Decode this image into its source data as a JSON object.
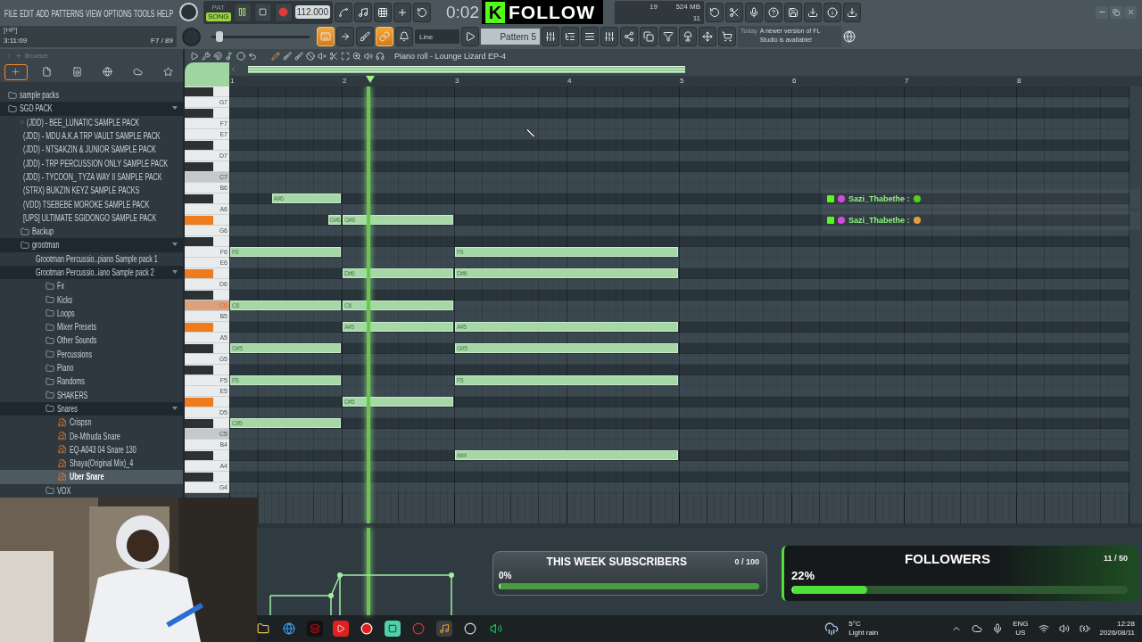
{
  "menu": [
    "FILE",
    "EDIT",
    "ADD",
    "PATTERNS",
    "VIEW",
    "OPTIONS",
    "TOOLS",
    "HELP"
  ],
  "mode": [
    {
      "label": "PAT",
      "selected": false
    },
    {
      "label": "SONG",
      "selected": true
    }
  ],
  "tempo": "112.000",
  "time": "0:02",
  "follow_overlay": {
    "logo": "K",
    "text": "FOLLOW"
  },
  "cpu": {
    "polyphony": "19",
    "memory": "524 MB",
    "cpu": "11"
  },
  "hint": {
    "title": "[HP]",
    "value": "3:11:09",
    "info": "F7 / 89"
  },
  "pitch_slider": {
    "level": 0.05
  },
  "toggles": [
    {
      "on": true
    },
    {
      "on": false
    },
    {
      "on": false
    },
    {
      "on": true
    },
    {
      "on": false
    }
  ],
  "snap": "Line",
  "pattern": "Pattern 5",
  "news": {
    "date": "Today",
    "message": "A newer version of FL Studio is available!"
  },
  "browser": {
    "title": "Browser",
    "tree": [
      {
        "kind": "folder",
        "label": "sample packs",
        "selected": false
      },
      {
        "kind": "folder",
        "label": "SGD PACK",
        "expanded": true,
        "selected": false,
        "children": [
          {
            "kind": "folder",
            "label": "(JDD) - BEE_LUNATIC SAMPLE PACK",
            "selected": false
          },
          {
            "kind": "folder",
            "label": "(JDD) - MDU A.K.A TRP VAULT SAMPLE PACK",
            "selected": false
          },
          {
            "kind": "folder",
            "label": "(JDD) - NTSAKZIN & JUNIOR SAMPLE PACK",
            "selected": false
          },
          {
            "kind": "folder",
            "label": "(JDD) - TRP PERCUSSION ONLY SAMPLE PACK",
            "selected": false
          },
          {
            "kind": "folder",
            "label": "(JDD) - TYCOON_ TYZA WAY II SAMPLE PACK",
            "selected": false
          },
          {
            "kind": "folder",
            "label": "(STRX) BUKZIN KEYZ SAMPLE PACKS",
            "selected": false
          },
          {
            "kind": "folder",
            "label": "(VDD) TSEBEBE MOROKE SAMPLE PACK",
            "selected": false
          },
          {
            "kind": "folder",
            "label": "[UPS] ULTIMATE SGIDONGO SAMPLE PACK",
            "selected": false
          },
          {
            "kind": "folder",
            "label": "Backup",
            "selected": false
          },
          {
            "kind": "folder",
            "label": "grootman",
            "expanded": true,
            "selected": false,
            "children": [
              {
                "kind": "folder",
                "label": "Grootman Percussio..piano Sample pack 1",
                "selected": false
              },
              {
                "kind": "folder",
                "label": "Grootman Percussio..iano Sample pack 2",
                "expanded": true,
                "selected": false,
                "children": [
                  {
                    "kind": "folder",
                    "label": "Fx",
                    "selected": false
                  },
                  {
                    "kind": "folder",
                    "label": "Kicks",
                    "selected": false
                  },
                  {
                    "kind": "folder",
                    "label": "Loops",
                    "selected": false
                  },
                  {
                    "kind": "folder",
                    "label": "Mixer Presets",
                    "selected": false
                  },
                  {
                    "kind": "folder",
                    "label": "Other Sounds",
                    "selected": false
                  },
                  {
                    "kind": "folder",
                    "label": "Percussions",
                    "selected": false
                  },
                  {
                    "kind": "folder",
                    "label": "Piano",
                    "selected": false
                  },
                  {
                    "kind": "folder",
                    "label": "Randoms",
                    "selected": false
                  },
                  {
                    "kind": "folder",
                    "label": "SHAKERS",
                    "selected": false
                  },
                  {
                    "kind": "folder",
                    "label": "Snares",
                    "expanded": true,
                    "selected": false,
                    "children": [
                      {
                        "kind": "file",
                        "label": "Crispsn",
                        "selected": false
                      },
                      {
                        "kind": "file",
                        "label": "De-Mthuda Snare",
                        "selected": false
                      },
                      {
                        "kind": "file",
                        "label": "EQ-A043 04 Snare 130",
                        "selected": false
                      },
                      {
                        "kind": "file",
                        "label": "Shaya(Original Mix)_4",
                        "selected": false
                      },
                      {
                        "kind": "file",
                        "label": "Uber Snare",
                        "selected": true
                      }
                    ]
                  },
                  {
                    "kind": "folder",
                    "label": "VOX",
                    "selected": false
                  }
                ]
              }
            ]
          }
        ]
      }
    ]
  },
  "piano_roll": {
    "title": "Piano roll - Lounge Lizard EP-4",
    "bars": [
      "1",
      "2",
      "3",
      "4",
      "5",
      "6",
      "7",
      "8"
    ],
    "keys": [
      {
        "kind": "black",
        "pressed": false
      },
      {
        "kind": "white",
        "label": "G7",
        "pressed": false
      },
      {
        "kind": "black",
        "pressed": false
      },
      {
        "kind": "white",
        "label": "F7",
        "pressed": false
      },
      {
        "kind": "white",
        "label": "E7",
        "pressed": false
      },
      {
        "kind": "black",
        "pressed": false
      },
      {
        "kind": "white",
        "label": "D7",
        "pressed": false
      },
      {
        "kind": "black",
        "pressed": false
      },
      {
        "kind": "c",
        "label": "C7",
        "pressed": false
      },
      {
        "kind": "white",
        "label": "B6",
        "pressed": false
      },
      {
        "kind": "black",
        "pressed": false,
        "notes": [
          {
            "label": "A#6"
          }
        ]
      },
      {
        "kind": "white",
        "label": "A6",
        "pressed": false
      },
      {
        "kind": "black",
        "pressed": true,
        "notes": [
          {
            "label": "G#6"
          },
          {
            "label": "G#6"
          }
        ]
      },
      {
        "kind": "white",
        "label": "G6",
        "pressed": false
      },
      {
        "kind": "black",
        "pressed": false
      },
      {
        "kind": "white",
        "label": "F6",
        "pressed": false,
        "notes": [
          {
            "label": "F6"
          },
          {
            "label": "F6"
          }
        ]
      },
      {
        "kind": "white",
        "label": "E6",
        "pressed": false
      },
      {
        "kind": "black",
        "pressed": true,
        "notes": [
          {
            "label": "D#6"
          },
          {
            "label": "D#6"
          }
        ]
      },
      {
        "kind": "white",
        "label": "D6",
        "pressed": false
      },
      {
        "kind": "black",
        "pressed": false
      },
      {
        "kind": "c",
        "label": "C6",
        "pressed": true,
        "notes": [
          {
            "label": "C6"
          },
          {
            "label": "C6"
          }
        ]
      },
      {
        "kind": "white",
        "label": "B5",
        "pressed": false
      },
      {
        "kind": "black",
        "pressed": true,
        "notes": [
          {
            "label": "A#5"
          },
          {
            "label": "A#5"
          }
        ]
      },
      {
        "kind": "white",
        "label": "A5",
        "pressed": false
      },
      {
        "kind": "black",
        "pressed": false,
        "notes": [
          {
            "label": "G#5"
          },
          {
            "label": "G#5"
          }
        ]
      },
      {
        "kind": "white",
        "label": "G5",
        "pressed": false
      },
      {
        "kind": "black",
        "pressed": false
      },
      {
        "kind": "white",
        "label": "F5",
        "pressed": false,
        "notes": [
          {
            "label": "F5"
          },
          {
            "label": "F5"
          }
        ]
      },
      {
        "kind": "white",
        "label": "E5",
        "pressed": false
      },
      {
        "kind": "black",
        "pressed": true,
        "notes": [
          {
            "label": "D#5"
          }
        ]
      },
      {
        "kind": "white",
        "label": "D5",
        "pressed": false
      },
      {
        "kind": "black",
        "pressed": false,
        "notes": [
          {
            "label": "C#5"
          }
        ]
      },
      {
        "kind": "c",
        "label": "C5",
        "pressed": false
      },
      {
        "kind": "white",
        "label": "B4",
        "pressed": false
      },
      {
        "kind": "black",
        "pressed": false,
        "notes": [
          {
            "label": "A#4"
          }
        ]
      },
      {
        "kind": "white",
        "label": "A4",
        "pressed": false
      },
      {
        "kind": "black",
        "pressed": false
      },
      {
        "kind": "white",
        "label": "G4",
        "pressed": false
      }
    ]
  },
  "chat": [
    {
      "user": "Sazi_Thabethe :"
    },
    {
      "user": "Sazi_Thabethe :"
    }
  ],
  "widgets": [
    {
      "kind": "subscribers",
      "title": "THIS WEEK SUBSCRIBERS",
      "count": "0 / 100",
      "percent": "0%",
      "level": 0
    },
    {
      "kind": "followers",
      "title": "FOLLOWERS",
      "count": "11 / 50",
      "percent": "22%",
      "level": 0.22
    }
  ],
  "taskbar": {
    "temp": "5°C",
    "weather": "Light rain",
    "lang": "ENG",
    "region": "US",
    "time": "12:28",
    "date": "2026/08/11"
  }
}
